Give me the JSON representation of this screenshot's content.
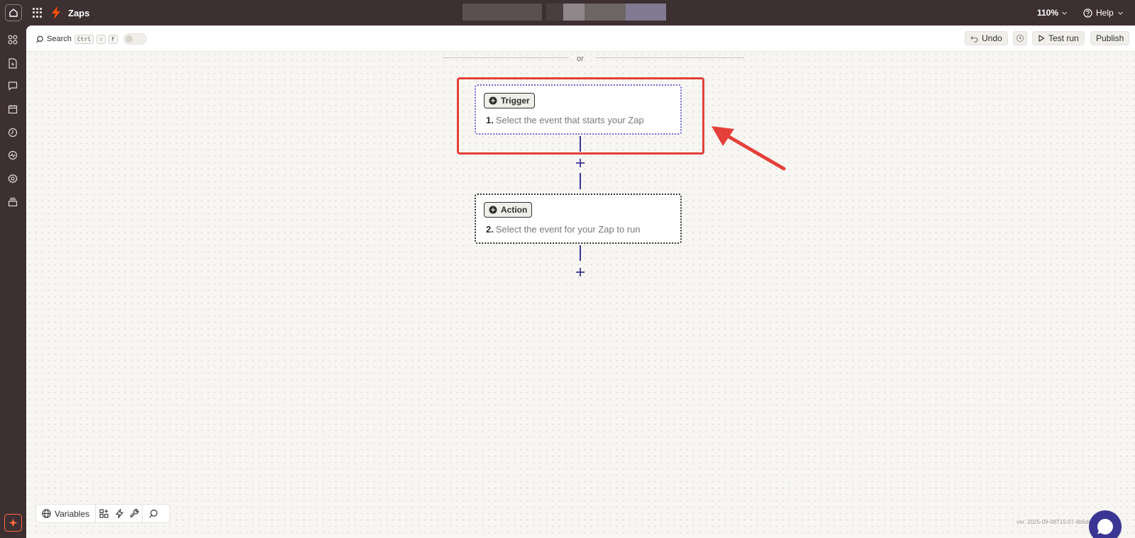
{
  "topbar": {
    "app_title": "Zaps",
    "zoom": "110%",
    "help_label": "Help"
  },
  "toolbar": {
    "search_label": "Search",
    "shortcut_keys": [
      "Ctrl",
      "⇧",
      "F"
    ],
    "undo_label": "Undo",
    "test_run_label": "Test run",
    "publish_label": "Publish"
  },
  "canvas": {
    "separator_text": "or",
    "trigger": {
      "badge": "Trigger",
      "step_number": "1.",
      "step_text": "Select the event that starts your Zap"
    },
    "action": {
      "badge": "Action",
      "step_number": "2.",
      "step_text": "Select the event for your Zap to run"
    }
  },
  "bottom_toolbar": {
    "variables_label": "Variables"
  },
  "version_text": "ver. 2025-09-08T15:07-4b6de9aa",
  "colors": {
    "topbar_bg": "#3d3032",
    "accent": "#3b3593",
    "highlight": "#e5403a",
    "brand_orange": "#ff4f00"
  },
  "icons": [
    "home-icon",
    "app-grid-icon",
    "zap-bolt-icon",
    "help-circle-icon",
    "chevron-down-icon",
    "search-icon",
    "undo-icon",
    "play-icon",
    "plus-icon",
    "globe-icon",
    "chat-icon"
  ]
}
